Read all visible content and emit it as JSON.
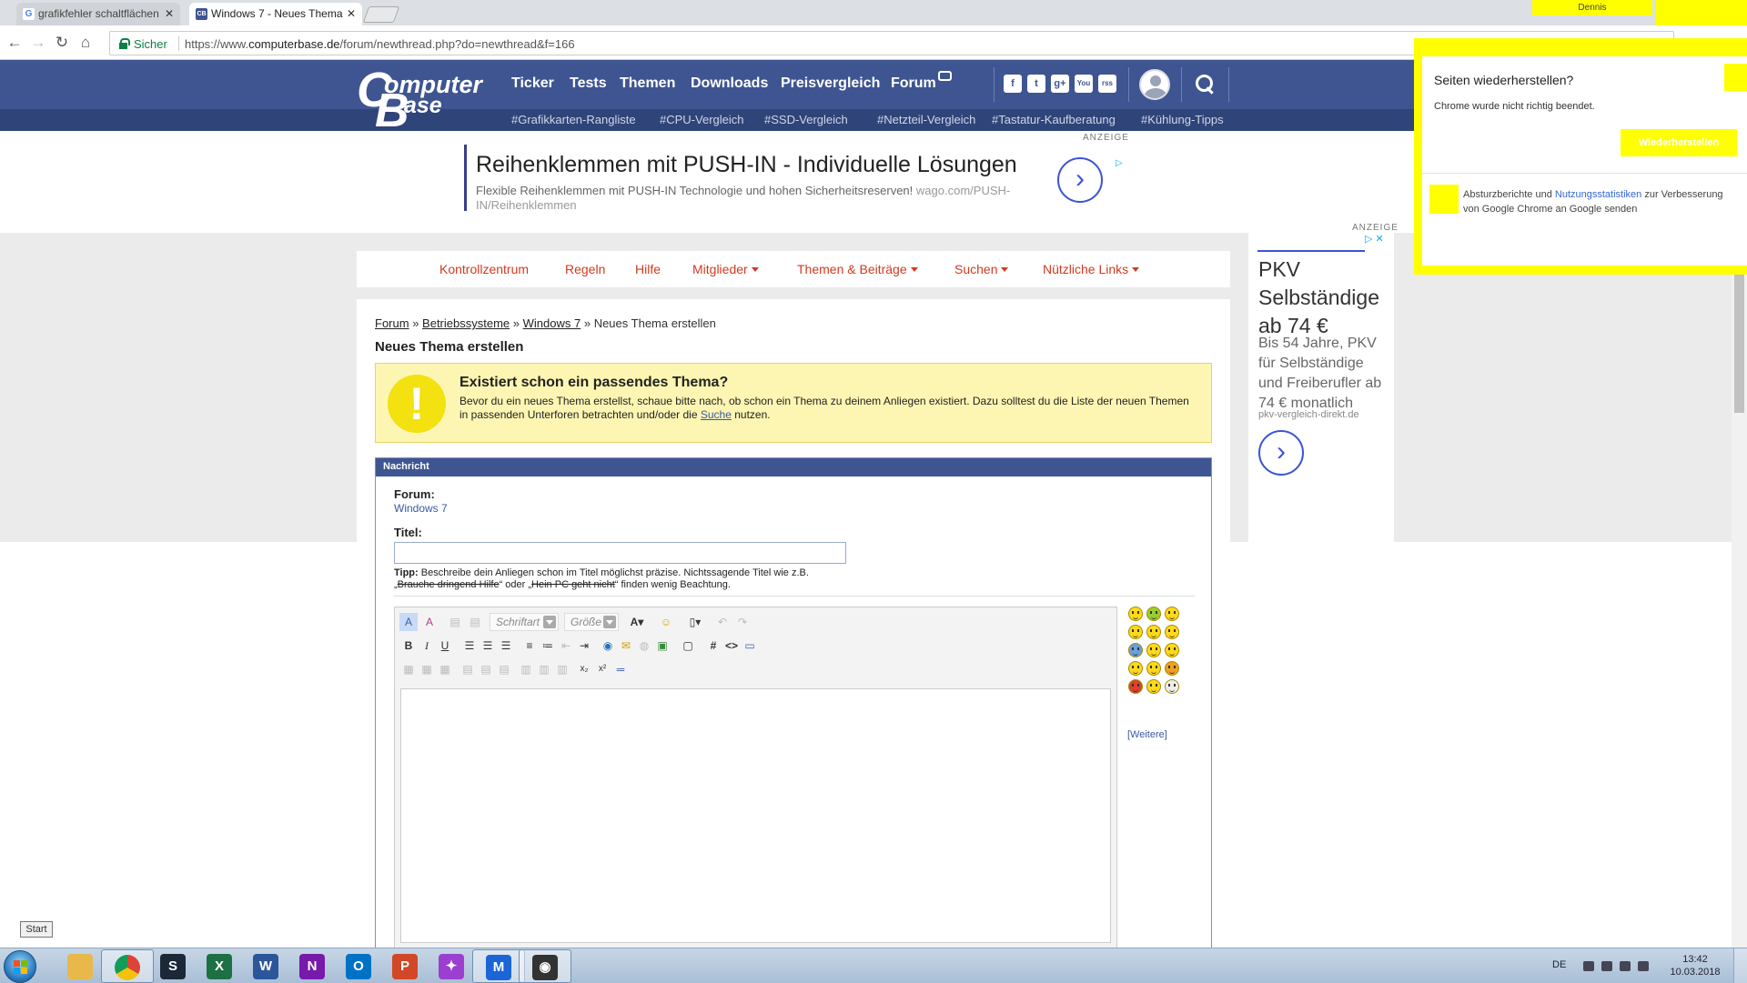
{
  "browser": {
    "tabs": [
      {
        "title": "grafikfehler schaltflächen",
        "favicon": "G",
        "active": false
      },
      {
        "title": "Windows 7 - Neues Thema",
        "favicon": "CB",
        "active": true
      }
    ],
    "profile_name": "Dennis",
    "secure_label": "Sicher",
    "url_prefix": "https://www.",
    "url_domain": "computerbase.de",
    "url_path": "/forum/newthread.php?do=newthread&f=166"
  },
  "site": {
    "logo": {
      "c": "C",
      "omputer": "omputer",
      "b": "B",
      "ase": "ase"
    },
    "nav": [
      "Ticker",
      "Tests",
      "Themen",
      "Downloads",
      "Preisvergleich",
      "Forum"
    ],
    "social": [
      "f",
      "t",
      "g+",
      "You",
      "rss"
    ],
    "hashtags": [
      "#Grafikkarten-Rangliste",
      "#CPU-Vergleich",
      "#SSD-Vergleich",
      "#Netzteil-Vergleich",
      "#Tastatur-Kaufberatung",
      "#Kühlung-Tipps"
    ]
  },
  "top_ad": {
    "label": "ANZEIGE",
    "title": "Reihenklemmen mit PUSH-IN - Individuelle Lösungen",
    "description": "Flexible Reihenklemmen mit PUSH-IN Technologie und hohen Sicherheitsreserven!",
    "domain": "wago.com/PUSH-IN/Reihenklemmen",
    "arrow": "›"
  },
  "forum_nav": [
    {
      "label": "Kontrollzentrum",
      "dropdown": false
    },
    {
      "label": "Regeln",
      "dropdown": false
    },
    {
      "label": "Hilfe",
      "dropdown": false
    },
    {
      "label": "Mitglieder",
      "dropdown": true
    },
    {
      "label": "Themen & Beiträge",
      "dropdown": true
    },
    {
      "label": "Suchen",
      "dropdown": true
    },
    {
      "label": "Nützliche Links",
      "dropdown": true
    }
  ],
  "breadcrumb": {
    "items": [
      "Forum",
      "Betriebssysteme",
      "Windows 7"
    ],
    "separator": "»",
    "current": "Neues Thema erstellen"
  },
  "page_title": "Neues Thema erstellen",
  "notice": {
    "icon": "!",
    "title": "Existiert schon ein passendes Thema?",
    "text_before": "Bevor du ein neues Thema erstellst, schaue bitte nach, ob schon ein Thema zu deinem Anliegen existiert. Dazu solltest du die Liste der neuen Themen in passenden Unterforen betrachten und/oder die ",
    "link": "Suche",
    "text_after": " nutzen."
  },
  "message_form": {
    "header": "Nachricht",
    "forum_label": "Forum:",
    "forum_value": "Windows 7",
    "title_label": "Titel:",
    "title_value": "",
    "tip_label": "Tipp:",
    "tip_text_1": " Beschreibe dein Anliegen schon im Titel möglichst präzise. Nichtssagende Titel wie z.B. „",
    "tip_bad_1": "Brauche dringend Hilfe",
    "tip_text_2": "“ oder „",
    "tip_bad_2": "Hein PC geht nicht",
    "tip_text_3": "“ finden wenig Beachtung."
  },
  "editor": {
    "font_placeholder": "Schriftart",
    "size_placeholder": "Größe",
    "content": ""
  },
  "smilies": {
    "more_label": "[Weitere]"
  },
  "side_ad": {
    "label": "ANZEIGE",
    "title": "PKV Selbständige ab 74 €",
    "text": "Bis 54 Jahre, PKV für Selbständige und Freiberufler ab 74 € monatlich",
    "domain": "pkv-vergleich-direkt.de",
    "arrow": "›"
  },
  "restore_popup": {
    "title": "Seiten wiederherstellen?",
    "message": "Chrome wurde nicht richtig beendet.",
    "button": "Wiederherstellen",
    "report_before": "Absturzberichte und ",
    "report_link": "Nutzungsstatistiken",
    "report_after": " zur Verbesserung von Google Chrome an Google senden"
  },
  "taskbar": {
    "start_tooltip": "Start",
    "language": "DE",
    "time": "13:42",
    "date": "10.03.2018",
    "apps": [
      {
        "name": "explorer",
        "color": "#e8b84a",
        "letter": ""
      },
      {
        "name": "chrome",
        "color": "#db4437",
        "letter": "",
        "active": true
      },
      {
        "name": "steam",
        "color": "#1b2838",
        "letter": "S"
      },
      {
        "name": "excel",
        "color": "#1d7044",
        "letter": "X"
      },
      {
        "name": "word",
        "color": "#2b579a",
        "letter": "W"
      },
      {
        "name": "onenote",
        "color": "#7719aa",
        "letter": "N"
      },
      {
        "name": "outlook",
        "color": "#0072c6",
        "letter": "O"
      },
      {
        "name": "powerpoint",
        "color": "#d24726",
        "letter": "P"
      },
      {
        "name": "game-app",
        "color": "#9b3fd1",
        "letter": "✦"
      },
      {
        "name": "malwarebytes",
        "color": "#1a66d8",
        "letter": "M",
        "active": true
      },
      {
        "name": "media-app",
        "color": "#333333",
        "letter": "◉",
        "active": true
      }
    ]
  },
  "colors": {
    "cb_blue": "#3e5591",
    "accent_red": "#d23a1f",
    "notice_yellow": "#fdf6b3",
    "highlight_yellow": "#ffff00"
  }
}
